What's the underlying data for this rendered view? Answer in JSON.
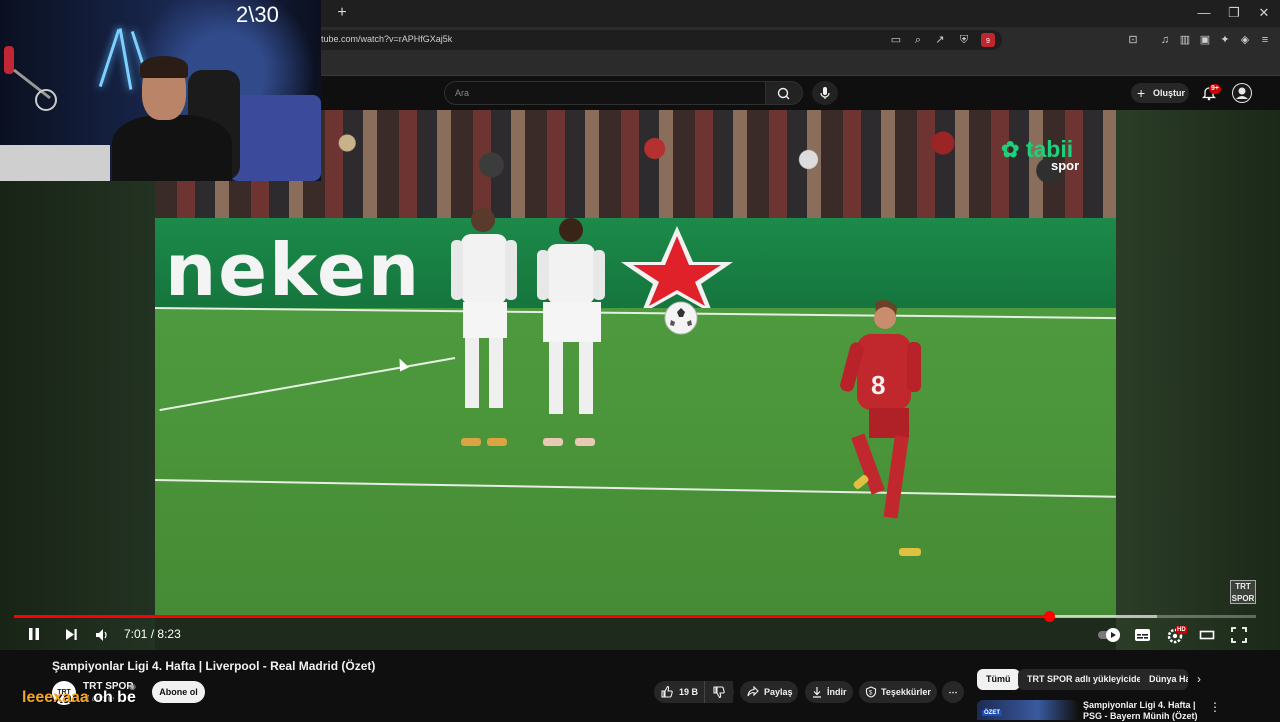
{
  "browser": {
    "url": "tube.com/watch?v=rAPHfGXaj5k",
    "extension_badge": "9"
  },
  "header": {
    "search_placeholder": "Ara",
    "create_label": "Oluştur",
    "notification_count": "9+"
  },
  "player": {
    "current_time": "7:01",
    "separator": "/",
    "duration": "8:23",
    "progress_fraction": 0.8337,
    "buffered_fraction": 0.92,
    "watermark_brand": "tabii",
    "watermark_sub": "spor",
    "channel_badge": "TRT SPOR",
    "board_text": "neken",
    "hd_badge": "HD",
    "accent_color": "#ff0000"
  },
  "webcam": {
    "counter": "2\\30"
  },
  "video_info": {
    "title": "Şampiyonlar Ligi 4. Hafta | Liverpool - Real Madrid (Özet)",
    "channel_avatar": "TRT",
    "channel_name": "TRT SPOR",
    "subscribers": "M abone",
    "subscribe_label": "Abone ol",
    "like_count": "19 B",
    "share_label": "Paylaş",
    "download_label": "İndir",
    "thanks_label": "Teşekkürler",
    "more_label": "⋯",
    "overlay_name_part1": "leeexaaa",
    "overlay_name_part2": "oh be"
  },
  "sidebar": {
    "chips": [
      "Tümü",
      "TRT SPOR adlı yükleyiciden",
      "Dünya Ha"
    ],
    "recommendation": {
      "title": "Şampiyonlar Ligi 4. Hafta | PSG - Bayern Münih (Özet)",
      "badge": "ÖZET"
    }
  }
}
